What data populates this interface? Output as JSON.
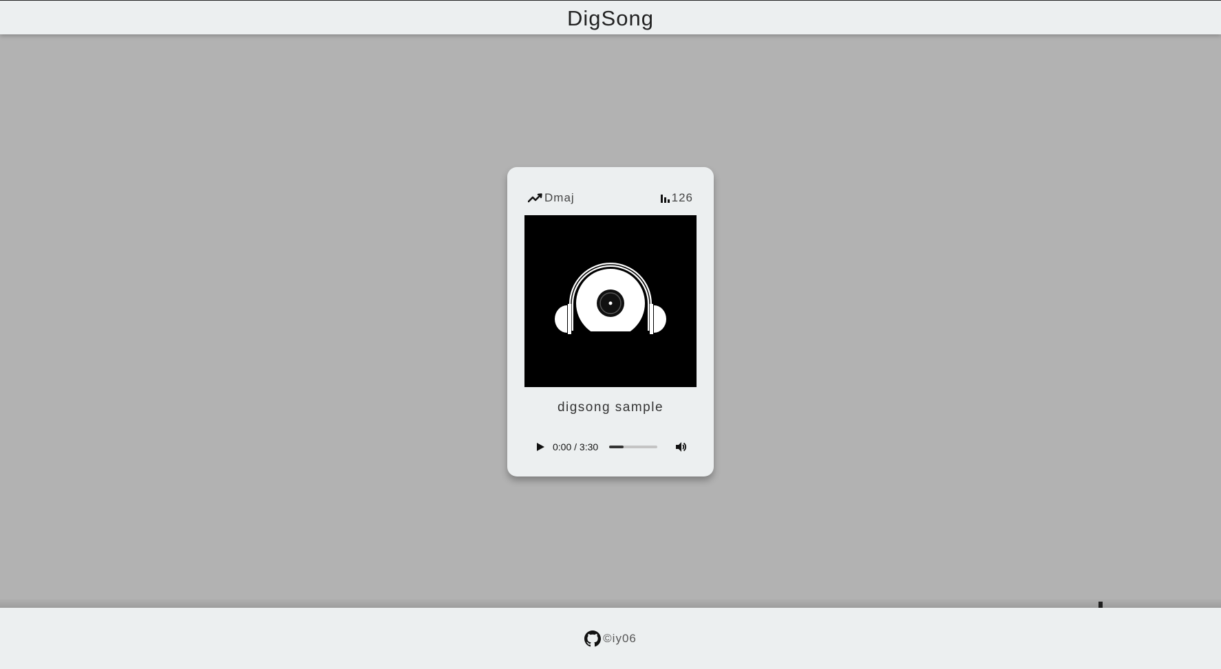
{
  "header": {
    "title": "DigSong"
  },
  "card": {
    "key": "Dmaj",
    "key_icon": "trending-up-icon",
    "bpm": "126",
    "bpm_icon": "bar-chart-icon",
    "cover_icon": "headphones-vinyl-icon",
    "song_title": "digsong sample",
    "player": {
      "play_icon": "play-icon",
      "time": "0:00 / 3:30",
      "progress_fraction": 0.3,
      "volume_icon": "volume-icon"
    }
  },
  "fab": {
    "icon": "plus-icon"
  },
  "footer": {
    "icon": "github-icon",
    "text": "©iy06"
  },
  "colors": {
    "background": "#b2b2b2",
    "bar": "#eceff0",
    "card": "#eceff0",
    "cover": "#000000"
  }
}
